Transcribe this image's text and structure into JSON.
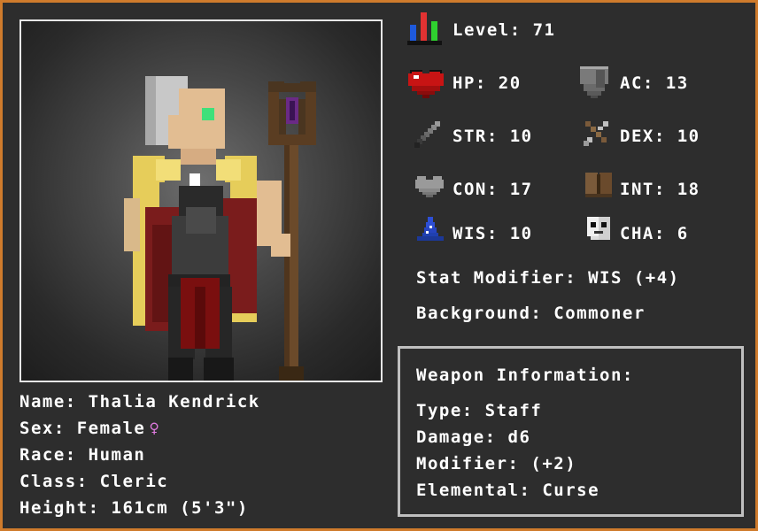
{
  "level": {
    "label": "Level:",
    "value": "71"
  },
  "stats": {
    "hp": {
      "label": "HP:",
      "value": "20"
    },
    "ac": {
      "label": "AC:",
      "value": "13"
    },
    "str": {
      "label": "STR:",
      "value": "10"
    },
    "dex": {
      "label": "DEX:",
      "value": "10"
    },
    "con": {
      "label": "CON:",
      "value": "17"
    },
    "int": {
      "label": "INT:",
      "value": "18"
    },
    "wis": {
      "label": "WIS:",
      "value": "10"
    },
    "cha": {
      "label": "CHA:",
      "value": "6"
    }
  },
  "stat_modifier": {
    "label": "Stat Modifier:",
    "value": "WIS (+4)"
  },
  "background": {
    "label": "Background:",
    "value": "Commoner"
  },
  "weapon": {
    "title": "Weapon Information:",
    "type": {
      "label": "Type:",
      "value": "Staff"
    },
    "damage": {
      "label": "Damage:",
      "value": "d6"
    },
    "modifier": {
      "label": "Modifier:",
      "value": "(+2)"
    },
    "elemental": {
      "label": "Elemental:",
      "value": "Curse"
    }
  },
  "character": {
    "name": {
      "label": "Name:",
      "value": "Thalia Kendrick"
    },
    "sex": {
      "label": "Sex:",
      "value": "Female",
      "symbol": "♀"
    },
    "race": {
      "label": "Race:",
      "value": "Human"
    },
    "class": {
      "label": "Class:",
      "value": "Cleric"
    },
    "height": {
      "label": "Height:",
      "value": "161cm (5'3\")"
    }
  },
  "colors": {
    "border": "#cf7b2c",
    "background": "#2d2d2d",
    "sex_symbol": "#e07be0"
  },
  "icons": {
    "level": "bar-chart-icon",
    "hp": "heart-icon",
    "ac": "shield-icon",
    "str": "sword-icon",
    "dex": "crossbow-icon",
    "con": "gray-heart-icon",
    "int": "book-icon",
    "wis": "wizard-hat-icon",
    "cha": "mask-icon"
  }
}
